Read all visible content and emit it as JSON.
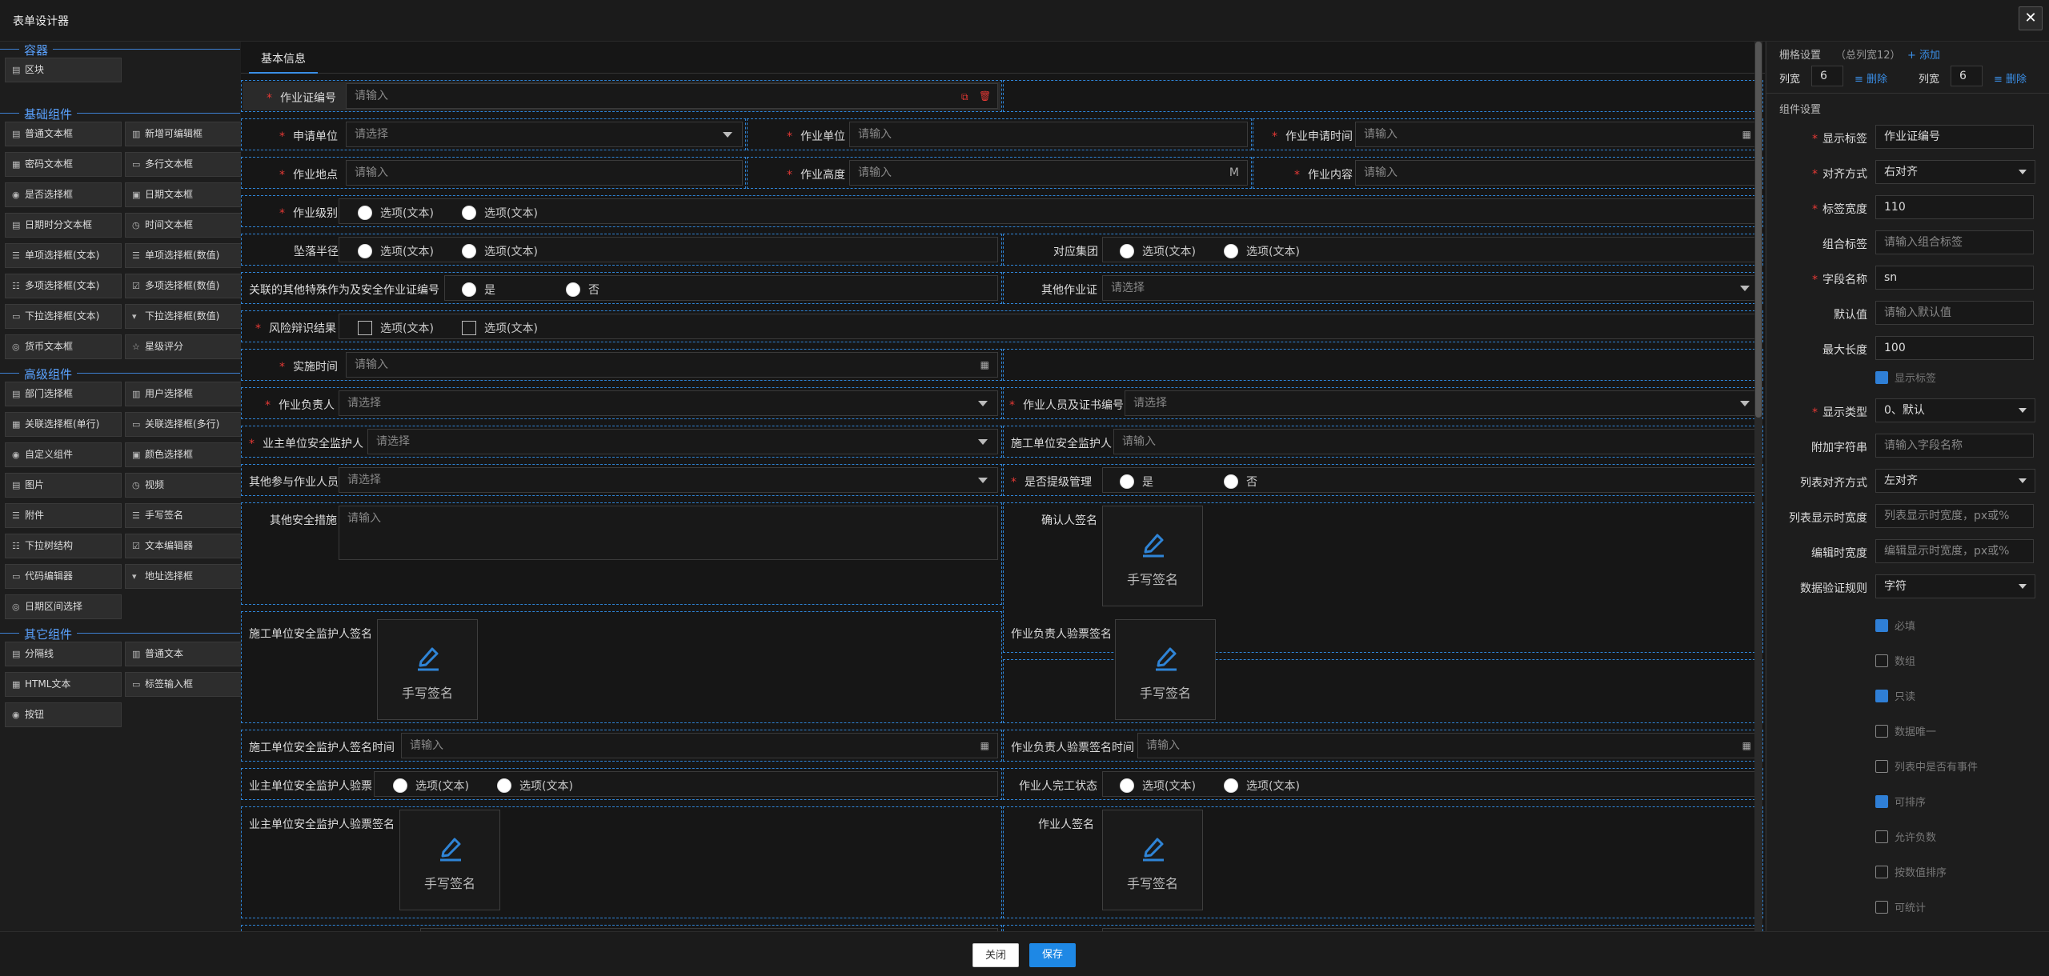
{
  "window": {
    "title": "表单设计器",
    "close_symbol": "✕"
  },
  "palette": {
    "container_title": "容器",
    "container_items": [
      "区块"
    ],
    "basic_title": "基础组件",
    "basic_items": [
      "普通文本框",
      "新增可编辑框",
      "密码文本框",
      "多行文本框",
      "是否选择框",
      "日期文本框",
      "日期时分文本框",
      "时间文本框",
      "单项选择框(文本)",
      "单项选择框(数值)",
      "多项选择框(文本)",
      "多项选择框(数值)",
      "下拉选择框(文本)",
      "下拉选择框(数值)",
      "货币文本框",
      "星级评分"
    ],
    "advanced_title": "高级组件",
    "advanced_items": [
      "部门选择框",
      "用户选择框",
      "关联选择框(单行)",
      "关联选择框(多行)",
      "自定义组件",
      "颜色选择框",
      "图片",
      "视频",
      "附件",
      "手写签名",
      "下拉树结构",
      "文本编辑器",
      "代码编辑器",
      "地址选择框",
      "日期区间选择"
    ],
    "other_title": "其它组件",
    "other_items": [
      "分隔线",
      "普通文本",
      "HTML文本",
      "标签输入框",
      "按钮"
    ]
  },
  "tab": "基本信息",
  "form": {
    "placeholder_input": "请输入",
    "placeholder_select": "请选择",
    "option_text": "选项(文本)",
    "yes": "是",
    "no": "否",
    "sign_text": "手写签名",
    "unit_m": "M",
    "labels": {
      "work_cert_no": "作业证编号",
      "apply_unit": "申请单位",
      "work_unit": "作业单位",
      "apply_time": "作业申请时间",
      "location": "作业地点",
      "height": "作业高度",
      "content": "作业内容",
      "level": "作业级别",
      "fall_radius": "坠落半径",
      "group": "对应集团",
      "related_cert": "关联的其他特殊作为及安全作业证编号",
      "other_cert": "其他作业证",
      "risk": "风险辩识结果",
      "impl_time": "实施时间",
      "leader": "作业负责人",
      "worker_cert": "作业人员及证书编号",
      "owner_supervisor": "业主单位安全监护人",
      "construct_supervisor": "施工单位安全监护人",
      "other_people": "其他参与作业人员",
      "upgrade": "是否提级管理",
      "other_measures": "其他安全措施",
      "confirm_sign": "确认人签名",
      "construct_sign": "施工单位安全监护人签名",
      "leader_accept_sign": "作业负责人验票签名",
      "construct_sign_time": "施工单位安全监护人签名时间",
      "leader_accept_time": "作业负责人验票签名时间",
      "owner_accept": "业主单位安全监护人验票",
      "worker_finish": "作业人完工状态",
      "owner_accept_sign": "业主单位安全监护人验票签名",
      "worker_sign": "作业人签名"
    }
  },
  "props": {
    "grid_title": "栅格设置",
    "grid_total": "（总列宽12）",
    "add": "+ 添加",
    "col_width": "列宽",
    "col1": "6",
    "col2": "6",
    "delete": "删除",
    "comp_title": "组件设置",
    "fields": [
      {
        "label": "显示标签",
        "value": "作业证编号",
        "req": true
      },
      {
        "label": "对齐方式",
        "value": "右对齐",
        "req": true,
        "select": true
      },
      {
        "label": "标签宽度",
        "value": "110",
        "req": true
      },
      {
        "label": "组合标签",
        "value": "请输入组合标签",
        "ph": true
      },
      {
        "label": "字段名称",
        "value": "sn",
        "req": true
      },
      {
        "label": "默认值",
        "value": "请输入默认值",
        "ph": true
      },
      {
        "label": "最大长度",
        "value": "100"
      }
    ],
    "show_label": "显示标签",
    "fields2": [
      {
        "label": "显示类型",
        "value": "0、默认",
        "req": true,
        "select": true
      },
      {
        "label": "附加字符串",
        "value": "请输入字段名称",
        "ph": true
      },
      {
        "label": "列表对齐方式",
        "value": "左对齐",
        "select": true
      },
      {
        "label": "列表显示时宽度",
        "value": "列表显示时宽度，px或%",
        "ph": true
      },
      {
        "label": "编辑时宽度",
        "value": "编辑显示时宽度，px或%",
        "ph": true
      },
      {
        "label": "数据验证规则",
        "value": "字符",
        "select": true
      }
    ],
    "checks": [
      {
        "label": "必填",
        "on": true
      },
      {
        "label": "数组",
        "on": false
      },
      {
        "label": "只读",
        "on": true
      },
      {
        "label": "数据唯一",
        "on": false
      },
      {
        "label": "列表中是否有事件",
        "on": false
      },
      {
        "label": "可排序",
        "on": true
      },
      {
        "label": "允许负数",
        "on": false
      },
      {
        "label": "按数值排序",
        "on": false
      },
      {
        "label": "可统计",
        "on": false
      }
    ]
  },
  "footer": {
    "close": "关闭",
    "save": "保存"
  },
  "colors": {
    "accent": "#2f84d6",
    "save_bg": "#1e88e5",
    "required": "#e53935"
  }
}
